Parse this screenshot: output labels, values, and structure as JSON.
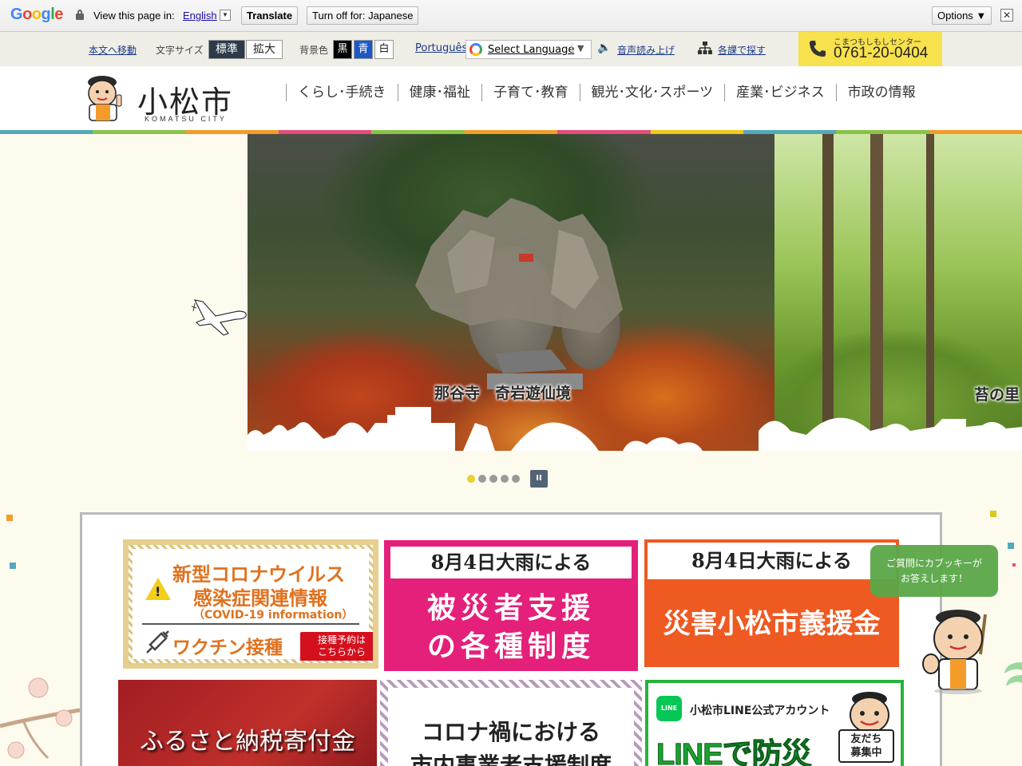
{
  "translate_bar": {
    "logo_letters": [
      {
        "ch": "G",
        "color": "#4285f4"
      },
      {
        "ch": "o",
        "color": "#ea4335"
      },
      {
        "ch": "o",
        "color": "#fbbc05"
      },
      {
        "ch": "g",
        "color": "#4285f4"
      },
      {
        "ch": "l",
        "color": "#34a853"
      },
      {
        "ch": "e",
        "color": "#ea4335"
      }
    ],
    "view_text": "View this page in:",
    "language": "English",
    "translate_label": "Translate",
    "turn_off_label": "Turn off for: Japanese",
    "options_label": "Options ▼",
    "close_label": "✕"
  },
  "utility": {
    "skip_link": "本文へ移動",
    "font_size_label": "文字サイズ",
    "font_standard": "標準",
    "font_large": "拡大",
    "bg_color_label": "背景色",
    "bg_black": "黒",
    "bg_blue": "青",
    "bg_white": "白",
    "portuguese_link": "Português",
    "select_language": "Select Language",
    "select_arrow": "▼",
    "speech_link": "音声読み上げ",
    "dept_search_link": "各課で探す"
  },
  "call_center": {
    "label": "こまつもしもしセンター",
    "number": "0761-20-0404"
  },
  "header": {
    "logo": "小松市",
    "logo_sub": "KOMATSU CITY",
    "nav": [
      "くらし･手続き",
      "健康･福祉",
      "子育て･教育",
      "観光･文化･スポーツ",
      "産業･ビジネス",
      "市政の情報"
    ]
  },
  "rainbow_colors": [
    "#53a9b8",
    "#8bc34a",
    "#f39c2a",
    "#e84c7a",
    "#8bc34a",
    "#f39c2a",
    "#e84c7a",
    "#f2c81b",
    "#53a9b8",
    "#8bc34a",
    "#f39c2a"
  ],
  "slider": {
    "slide1_caption": "那谷寺　奇岩遊仙境",
    "slide2_caption": "苔の里",
    "dot_count": 5,
    "active_dot": 0,
    "pause_label": "II"
  },
  "banners": {
    "covid": {
      "line1": "新型コロナウイルス",
      "line2": "感染症関連情報",
      "line3": "（COVID-19 information）",
      "line4": "ワクチン接種",
      "reserve": "接種予約は\nこちらから"
    },
    "disaster_support": {
      "head": "8月4日大雨による",
      "line1": "被災者支援",
      "line2": "の各種制度"
    },
    "donation": {
      "head": "8月4日大雨による",
      "line1": "災害小松市義援金"
    },
    "furusato": {
      "line1": "ふるさと納税寄付金"
    },
    "corona_business": {
      "line1": "コロナ禍における",
      "line2": "市内事業者支援制度"
    },
    "line_bousai": {
      "line1": "小松市LINE公式アカウント",
      "line2": "LINEで防災",
      "icon_text": "LINE",
      "tomodachi": "友だち\n募集中"
    }
  },
  "chat": {
    "text": "ご質問にカブッキーが\nお答えします！"
  }
}
